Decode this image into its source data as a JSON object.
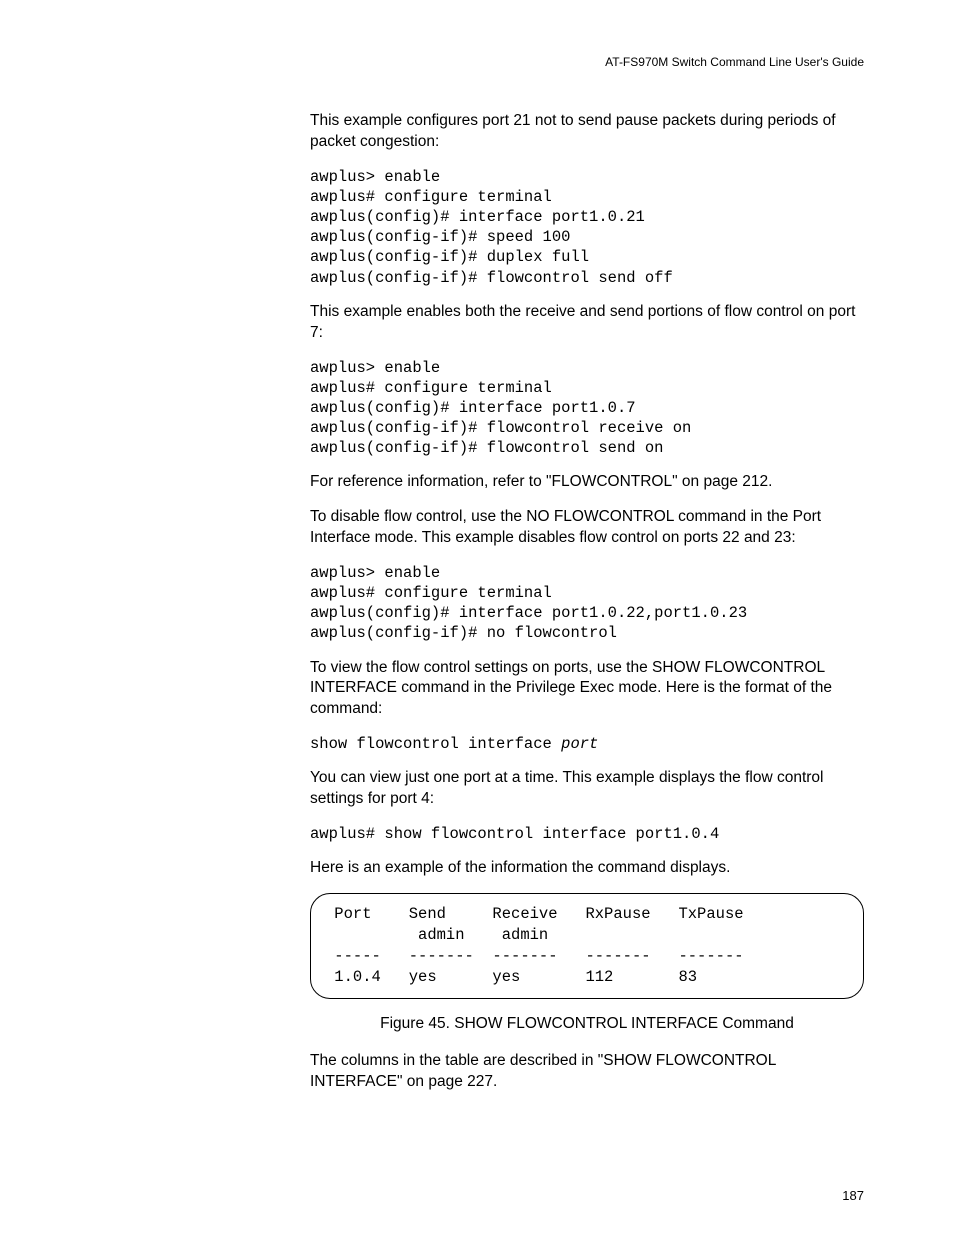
{
  "header": {
    "guide_title": "AT-FS970M Switch Command Line User's Guide"
  },
  "p1": "This example configures port 21 not to send pause packets during periods of packet congestion:",
  "code1": "awplus> enable\nawplus# configure terminal\nawplus(config)# interface port1.0.21\nawplus(config-if)# speed 100\nawplus(config-if)# duplex full\nawplus(config-if)# flowcontrol send off",
  "p2": "This example enables both the receive and send portions of flow control on port 7:",
  "code2": "awplus> enable\nawplus# configure terminal\nawplus(config)# interface port1.0.7\nawplus(config-if)# flowcontrol receive on\nawplus(config-if)# flowcontrol send on",
  "p3": "For reference information, refer to \"FLOWCONTROL\" on page 212.",
  "p4": "To disable flow control, use the NO FLOWCONTROL command in the Port Interface mode. This example disables flow control on ports 22 and 23:",
  "code3": "awplus> enable\nawplus# configure terminal\nawplus(config)# interface port1.0.22,port1.0.23\nawplus(config-if)# no flowcontrol",
  "p5": "To view the flow control settings on ports, use the SHOW FLOWCONTROL INTERFACE command in the Privilege Exec mode. Here is the format of the command:",
  "code4_prefix": "show flowcontrol interface ",
  "code4_param": "port",
  "p6": "You can view just one port at a time. This example displays the flow control settings for port 4:",
  "code5": "awplus# show flowcontrol interface port1.0.4",
  "p7": "Here is an example of the information the command displays.",
  "figure_box": " Port    Send     Receive   RxPause   TxPause\n          admin    admin\n -----   -------  -------   -------   -------\n 1.0.4   yes      yes       112       83",
  "figure_caption": "Figure 45. SHOW FLOWCONTROL INTERFACE Command",
  "p8": "The columns in the table are described in \"SHOW FLOWCONTROL INTERFACE\" on page 227.",
  "page_number": "187"
}
